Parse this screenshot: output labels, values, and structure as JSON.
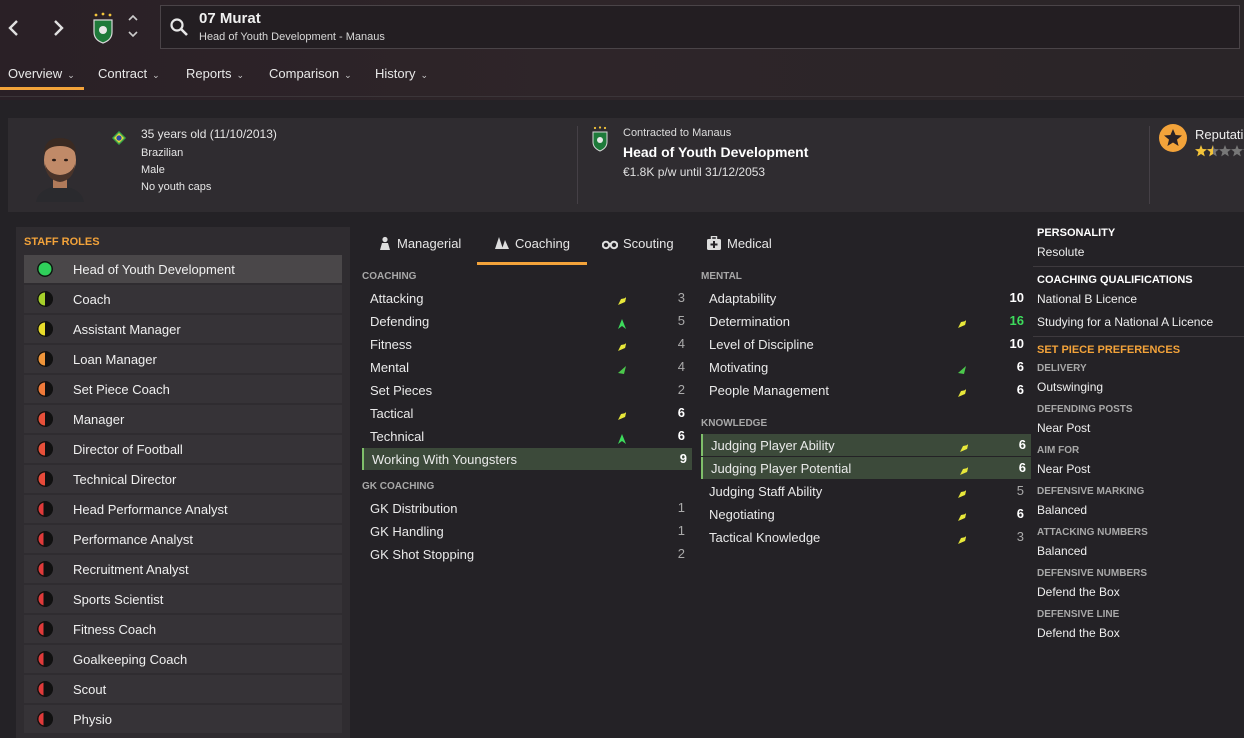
{
  "header": {
    "name": "07 Murat",
    "subtitle": "Head of Youth Development - Manaus",
    "nav_back_icon": "chevron-left-icon",
    "nav_forward_icon": "chevron-right-icon"
  },
  "tabs": [
    {
      "label": "Overview"
    },
    {
      "label": "Contract"
    },
    {
      "label": "Reports"
    },
    {
      "label": "Comparison"
    },
    {
      "label": "History"
    }
  ],
  "profile": {
    "age": "35 years old (11/10/2013)",
    "nationality": "Brazilian",
    "gender": "Male",
    "caps": "No youth caps",
    "contract_label": "Contracted to Manaus",
    "role": "Head of Youth Development",
    "wage": "€1.8K p/w until 31/12/2053",
    "reputation_label": "Reputati"
  },
  "staff_roles": {
    "title": "STAFF ROLES",
    "items": [
      {
        "label": "Head of Youth Development",
        "color": "#2fd05a",
        "fill": 1.0
      },
      {
        "label": "Coach",
        "color": "#a6d12a",
        "fill": 0.5
      },
      {
        "label": "Assistant Manager",
        "color": "#e8dc2a",
        "fill": 0.5
      },
      {
        "label": "Loan Manager",
        "color": "#f0953a",
        "fill": 0.5
      },
      {
        "label": "Set Piece Coach",
        "color": "#f07a3a",
        "fill": 0.5
      },
      {
        "label": "Manager",
        "color": "#e8503a",
        "fill": 0.5
      },
      {
        "label": "Director of Football",
        "color": "#e8503a",
        "fill": 0.5
      },
      {
        "label": "Technical Director",
        "color": "#e84a3a",
        "fill": 0.5
      },
      {
        "label": "Head Performance Analyst",
        "color": "#e03a3a",
        "fill": 0.4
      },
      {
        "label": "Performance Analyst",
        "color": "#e03a3a",
        "fill": 0.4
      },
      {
        "label": "Recruitment Analyst",
        "color": "#e03a3a",
        "fill": 0.4
      },
      {
        "label": "Sports Scientist",
        "color": "#e03a3a",
        "fill": 0.4
      },
      {
        "label": "Fitness Coach",
        "color": "#e03a3a",
        "fill": 0.4
      },
      {
        "label": "Goalkeeping Coach",
        "color": "#e03a3a",
        "fill": 0.4
      },
      {
        "label": "Scout",
        "color": "#e03a3a",
        "fill": 0.4
      },
      {
        "label": "Physio",
        "color": "#e03a3a",
        "fill": 0.4
      }
    ]
  },
  "attr_tabs": [
    {
      "label": "Managerial",
      "icon": "manager-icon"
    },
    {
      "label": "Coaching",
      "icon": "cone-icon"
    },
    {
      "label": "Scouting",
      "icon": "binoculars-icon"
    },
    {
      "label": "Medical",
      "icon": "medical-kit-icon"
    }
  ],
  "coaching": {
    "title": "COACHING",
    "rows": [
      {
        "name": "Attacking",
        "value": "3",
        "arrow": "yellow"
      },
      {
        "name": "Defending",
        "value": "5",
        "arrow": "green-up"
      },
      {
        "name": "Fitness",
        "value": "4",
        "arrow": "yellow"
      },
      {
        "name": "Mental",
        "value": "4",
        "arrow": "green"
      },
      {
        "name": "Set Pieces",
        "value": "2",
        "arrow": ""
      },
      {
        "name": "Tactical",
        "value": "6",
        "arrow": "yellow"
      },
      {
        "name": "Technical",
        "value": "6",
        "arrow": "green-up"
      },
      {
        "name": "Working With Youngsters",
        "value": "9",
        "arrow": ""
      }
    ]
  },
  "gk_coaching": {
    "title": "GK COACHING",
    "rows": [
      {
        "name": "GK Distribution",
        "value": "1"
      },
      {
        "name": "GK Handling",
        "value": "1"
      },
      {
        "name": "GK Shot Stopping",
        "value": "2"
      }
    ]
  },
  "mental": {
    "title": "MENTAL",
    "rows": [
      {
        "name": "Adaptability",
        "value": "10",
        "arrow": ""
      },
      {
        "name": "Determination",
        "value": "16",
        "arrow": "yellow"
      },
      {
        "name": "Level of Discipline",
        "value": "10",
        "arrow": ""
      },
      {
        "name": "Motivating",
        "value": "6",
        "arrow": "green"
      },
      {
        "name": "People Management",
        "value": "6",
        "arrow": "yellow"
      }
    ]
  },
  "knowledge": {
    "title": "KNOWLEDGE",
    "rows": [
      {
        "name": "Judging Player Ability",
        "value": "6",
        "arrow": "yellow"
      },
      {
        "name": "Judging Player Potential",
        "value": "6",
        "arrow": "yellow"
      },
      {
        "name": "Judging Staff Ability",
        "value": "5",
        "arrow": "yellow"
      },
      {
        "name": "Negotiating",
        "value": "6",
        "arrow": "yellow"
      },
      {
        "name": "Tactical Knowledge",
        "value": "3",
        "arrow": "yellow"
      }
    ]
  },
  "right_panel": {
    "personality_title": "PERSONALITY",
    "personality": "Resolute",
    "qualifications_title": "COACHING QUALIFICATIONS",
    "qualification_1": "National B Licence",
    "qualification_2": "Studying for a National A Licence",
    "set_piece_title": "SET PIECE PREFERENCES",
    "delivery_label": "DELIVERY",
    "delivery": "Outswinging",
    "defending_posts_label": "DEFENDING POSTS",
    "defending_posts": "Near Post",
    "aim_for_label": "AIM FOR",
    "aim_for": "Near Post",
    "def_marking_label": "DEFENSIVE MARKING",
    "def_marking": "Balanced",
    "att_numbers_label": "ATTACKING NUMBERS",
    "att_numbers": "Balanced",
    "def_numbers_label": "DEFENSIVE NUMBERS",
    "def_numbers": "Defend the Box",
    "def_line_label": "DEFENSIVE LINE",
    "def_line": "Defend the Box"
  },
  "colors": {
    "accent": "#f3a33a",
    "highlight_row": "#3c4a3a",
    "good_value": "#3ddc5c"
  }
}
